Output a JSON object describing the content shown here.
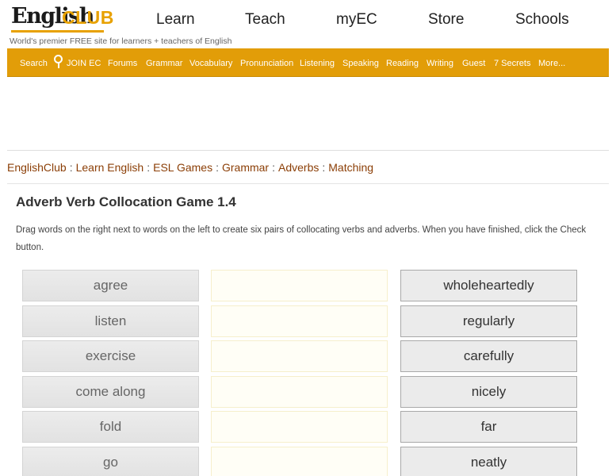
{
  "header": {
    "logo_english": "English",
    "logo_club": "CLUB",
    "tagline": "World's premier FREE site for learners + teachers of English",
    "nav": [
      "Learn",
      "Teach",
      "myEC",
      "Store",
      "Schools"
    ]
  },
  "menu": {
    "search_label": "Search",
    "items": [
      "JOIN EC",
      "Forums",
      "Grammar",
      "Vocabulary",
      "Pronunciation",
      "Listening",
      "Speaking",
      "Reading",
      "Writing",
      "Guest",
      "7 Secrets",
      "More..."
    ],
    "color": "#e29d08"
  },
  "breadcrumb": [
    "EnglishClub",
    "Learn English",
    "ESL Games",
    "Grammar",
    "Adverbs",
    "Matching"
  ],
  "page": {
    "title": "Adverb Verb Collocation Game 1.4",
    "instructions": "Drag words on the right next to words on the left to create six pairs of collocating verbs and adverbs. When you have finished, click the Check button."
  },
  "game": {
    "verbs": [
      "agree",
      "listen",
      "exercise",
      "come along",
      "fold",
      "go"
    ],
    "adverbs": [
      "wholeheartedly",
      "regularly",
      "carefully",
      "nicely",
      "far",
      "neatly"
    ]
  }
}
